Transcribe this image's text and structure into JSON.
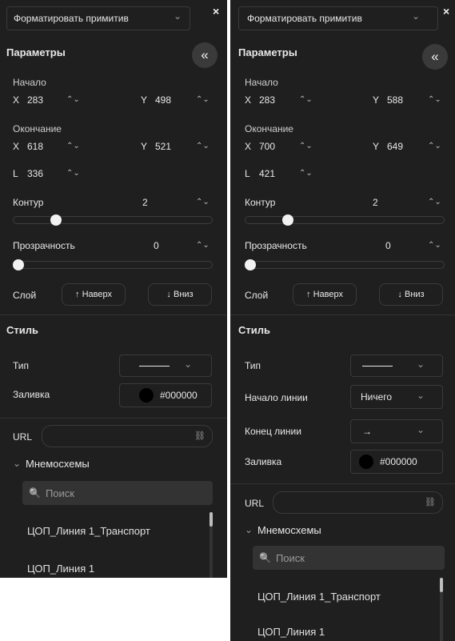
{
  "left": {
    "dropdown": "Форматировать примитив",
    "params_title": "Параметры",
    "collapse_glyph": "«",
    "start_label": "Начало",
    "start_x": "283",
    "start_y": "498",
    "end_label": "Окончание",
    "end_x": "618",
    "end_y": "521",
    "length": "336",
    "outline_label": "Контур",
    "outline_value": "2",
    "outline_level": 0.2,
    "opacity_label": "Прозрачность",
    "opacity_value": "0",
    "opacity_level": 0,
    "layer_label": "Слой",
    "up_label": "↑ Наверх",
    "down_label": "↓ Вниз",
    "style_title": "Стиль",
    "type_label": "Тип",
    "fill_label": "Заливка",
    "fill_value": "#000000",
    "url_label": "URL",
    "mnemo_label": "Мнемосхемы",
    "search_placeholder": "Поиск",
    "list_items": [
      "ЦОП_Линия 1_Транспорт",
      "ЦОП_Линия 1"
    ]
  },
  "right": {
    "dropdown": "Форматировать примитив",
    "params_title": "Параметры",
    "collapse_glyph": "«",
    "start_label": "Начало",
    "start_x": "283",
    "start_y": "588",
    "end_label": "Окончание",
    "end_x": "700",
    "end_y": "649",
    "length": "421",
    "outline_label": "Контур",
    "outline_value": "2",
    "outline_level": 0.2,
    "opacity_label": "Прозрачность",
    "opacity_value": "0",
    "opacity_level": 0,
    "layer_label": "Слой",
    "up_label": "↑ Наверх",
    "down_label": "↓ Вниз",
    "style_title": "Стиль",
    "type_label": "Тип",
    "line_start_label": "Начало линии",
    "line_start_value": "Ничего",
    "line_end_label": "Конец линии",
    "line_end_value": "→",
    "fill_label": "Заливка",
    "fill_value": "#000000",
    "url_label": "URL",
    "mnemo_label": "Мнемосхемы",
    "search_placeholder": "Поиск",
    "list_items": [
      "ЦОП_Линия 1_Транспорт",
      "ЦОП_Линия 1"
    ]
  },
  "labels": {
    "x": "X",
    "y": "Y",
    "l": "L",
    "close": "×",
    "spin": "⌃⌄",
    "chevron": "⌄",
    "search_icon": "🔍",
    "link_icon": "⛓",
    "expand_chevron": "⌄"
  },
  "colors": {
    "panel_bg": "#1f1f1f",
    "border": "#3a3a3a",
    "knob": "#f2f2f2",
    "fill_swatch": "#000000"
  }
}
